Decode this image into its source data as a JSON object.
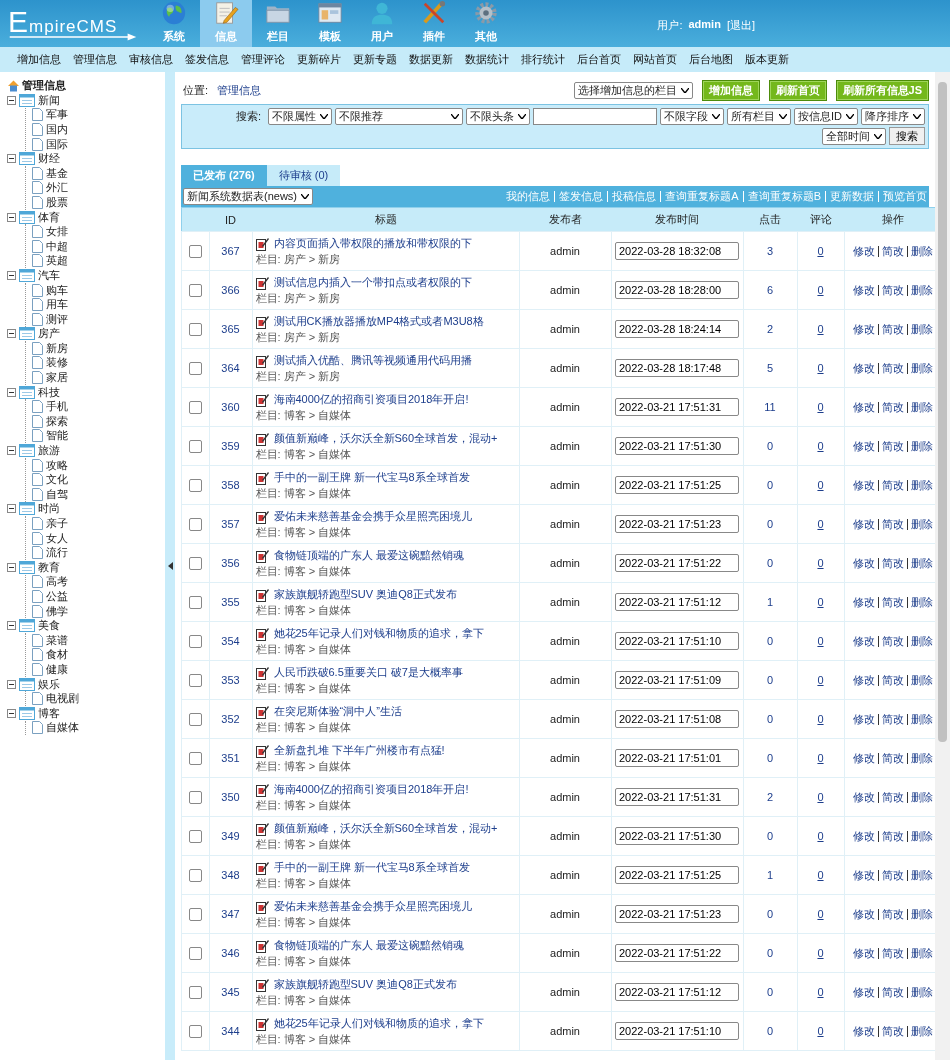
{
  "header": {
    "logo": {
      "initial": "E",
      "rest": "mpireCMS"
    },
    "tabs": [
      {
        "label": "系统",
        "selected": false
      },
      {
        "label": "信息",
        "selected": true
      },
      {
        "label": "栏目",
        "selected": false
      },
      {
        "label": "模板",
        "selected": false
      },
      {
        "label": "用户",
        "selected": false
      },
      {
        "label": "插件",
        "selected": false
      },
      {
        "label": "其他",
        "selected": false
      }
    ],
    "user": {
      "label": "用户:",
      "name": "admin",
      "logout": "[退出]"
    }
  },
  "menu": [
    "增加信息",
    "管理信息",
    "审核信息",
    "签发信息",
    "管理评论",
    "更新碎片",
    "更新专题",
    "数据更新",
    "数据统计",
    "排行统计",
    "后台首页",
    "网站首页",
    "后台地图",
    "版本更新"
  ],
  "sidebar": {
    "root": "管理信息",
    "items": [
      {
        "label": "新闻",
        "expanded": true,
        "children": [
          {
            "label": "军事"
          },
          {
            "label": "国内"
          },
          {
            "label": "国际"
          }
        ]
      },
      {
        "label": "财经",
        "expanded": true,
        "children": [
          {
            "label": "基金"
          },
          {
            "label": "外汇"
          },
          {
            "label": "股票"
          }
        ]
      },
      {
        "label": "体育",
        "expanded": true,
        "children": [
          {
            "label": "女排"
          },
          {
            "label": "中超"
          },
          {
            "label": "英超"
          }
        ]
      },
      {
        "label": "汽车",
        "expanded": true,
        "children": [
          {
            "label": "购车"
          },
          {
            "label": "用车"
          },
          {
            "label": "测评"
          }
        ]
      },
      {
        "label": "房产",
        "expanded": true,
        "children": [
          {
            "label": "新房"
          },
          {
            "label": "装修"
          },
          {
            "label": "家居"
          }
        ]
      },
      {
        "label": "科技",
        "expanded": true,
        "children": [
          {
            "label": "手机"
          },
          {
            "label": "探索"
          },
          {
            "label": "智能"
          }
        ]
      },
      {
        "label": "旅游",
        "expanded": true,
        "children": [
          {
            "label": "攻略"
          },
          {
            "label": "文化"
          },
          {
            "label": "自驾"
          }
        ]
      },
      {
        "label": "时尚",
        "expanded": true,
        "children": [
          {
            "label": "亲子"
          },
          {
            "label": "女人"
          },
          {
            "label": "流行"
          }
        ]
      },
      {
        "label": "教育",
        "expanded": true,
        "children": [
          {
            "label": "高考"
          },
          {
            "label": "公益"
          },
          {
            "label": "佛学"
          }
        ]
      },
      {
        "label": "美食",
        "expanded": true,
        "children": [
          {
            "label": "菜谱"
          },
          {
            "label": "食材"
          },
          {
            "label": "健康"
          }
        ]
      },
      {
        "label": "娱乐",
        "expanded": true,
        "children": [
          {
            "label": "电视剧"
          }
        ]
      },
      {
        "label": "博客",
        "expanded": true,
        "children": [
          {
            "label": "自媒体"
          }
        ]
      }
    ]
  },
  "location": {
    "label": "位置:",
    "link": "管理信息"
  },
  "add_column_select": "选择增加信息的栏目",
  "action_buttons": [
    "增加信息",
    "刷新首页",
    "刷新所有信息JS"
  ],
  "search": {
    "label": "搜索:",
    "filters": [
      "不限属性",
      "不限推荐",
      "不限头条"
    ],
    "filters_2": [
      "不限字段",
      "所有栏目",
      "按信息ID",
      "降序排序",
      "全部时间"
    ],
    "button": "搜索"
  },
  "tabs": [
    {
      "label": "已发布 (276)",
      "selected": true
    },
    {
      "label": "待审核 (0)",
      "selected": false
    }
  ],
  "table_select": "新闻系统数据表(news)",
  "table_links": [
    "我的信息",
    "签发信息",
    "投稿信息",
    "查询重复标题A",
    "查询重复标题B",
    "更新数据",
    "预览首页"
  ],
  "table": {
    "columns": [
      "ID",
      "标题",
      "发布者",
      "发布时间",
      "点击",
      "评论",
      "操作"
    ],
    "rows": [
      {
        "checked": false,
        "id": "367",
        "title": "内容页面插入带权限的播放和带权限的下",
        "category": "栏目: 房产 > 新房",
        "author": "admin",
        "time": "2022-03-28 18:32:08",
        "clicks": "3",
        "comments": "0",
        "actions": [
          "修改",
          "简改",
          "删除"
        ]
      },
      {
        "checked": false,
        "id": "366",
        "title": "测试信息内插入一个带扣点或者权限的下",
        "category": "栏目: 房产 > 新房",
        "author": "admin",
        "time": "2022-03-28 18:28:00",
        "clicks": "6",
        "comments": "0",
        "actions": [
          "修改",
          "简改",
          "删除"
        ]
      },
      {
        "checked": false,
        "id": "365",
        "title": "测试用CK播放器播放MP4格式或者M3U8格",
        "category": "栏目: 房产 > 新房",
        "author": "admin",
        "time": "2022-03-28 18:24:14",
        "clicks": "2",
        "comments": "0",
        "actions": [
          "修改",
          "简改",
          "删除"
        ]
      },
      {
        "checked": false,
        "id": "364",
        "title": "测试插入优酷、腾讯等视频通用代码用播",
        "category": "栏目: 房产 > 新房",
        "author": "admin",
        "time": "2022-03-28 18:17:48",
        "clicks": "5",
        "comments": "0",
        "actions": [
          "修改",
          "简改",
          "删除"
        ]
      },
      {
        "checked": false,
        "id": "360",
        "title": "海南4000亿的招商引资项目2018年开启!",
        "category": "栏目: 博客 > 自媒体",
        "author": "admin",
        "time": "2022-03-21 17:51:31",
        "clicks": "11",
        "comments": "0",
        "actions": [
          "修改",
          "简改",
          "删除"
        ]
      },
      {
        "checked": false,
        "id": "359",
        "title": "颜值新巅峰，沃尔沃全新S60全球首发，混动+",
        "category": "栏目: 博客 > 自媒体",
        "author": "admin",
        "time": "2022-03-21 17:51:30",
        "clicks": "0",
        "comments": "0",
        "actions": [
          "修改",
          "简改",
          "删除"
        ]
      },
      {
        "checked": false,
        "id": "358",
        "title": "手中的一副王牌 新一代宝马8系全球首发",
        "category": "栏目: 博客 > 自媒体",
        "author": "admin",
        "time": "2022-03-21 17:51:25",
        "clicks": "0",
        "comments": "0",
        "actions": [
          "修改",
          "简改",
          "删除"
        ]
      },
      {
        "checked": false,
        "id": "357",
        "title": "爱佑未来慈善基金会携手众星照亮困境儿",
        "category": "栏目: 博客 > 自媒体",
        "author": "admin",
        "time": "2022-03-21 17:51:23",
        "clicks": "0",
        "comments": "0",
        "actions": [
          "修改",
          "简改",
          "删除"
        ]
      },
      {
        "checked": false,
        "id": "356",
        "title": "食物链顶端的广东人 最爱这碗黯然销魂",
        "category": "栏目: 博客 > 自媒体",
        "author": "admin",
        "time": "2022-03-21 17:51:22",
        "clicks": "0",
        "comments": "0",
        "actions": [
          "修改",
          "简改",
          "删除"
        ]
      },
      {
        "checked": false,
        "id": "355",
        "title": "家族旗舰轿跑型SUV 奥迪Q8正式发布",
        "category": "栏目: 博客 > 自媒体",
        "author": "admin",
        "time": "2022-03-21 17:51:12",
        "clicks": "1",
        "comments": "0",
        "actions": [
          "修改",
          "简改",
          "删除"
        ]
      },
      {
        "checked": false,
        "id": "354",
        "title": "她花25年记录人们对钱和物质的追求，拿下",
        "category": "栏目: 博客 > 自媒体",
        "author": "admin",
        "time": "2022-03-21 17:51:10",
        "clicks": "0",
        "comments": "0",
        "actions": [
          "修改",
          "简改",
          "删除"
        ]
      },
      {
        "checked": false,
        "id": "353",
        "title": "人民币跌破6.5重要关口 破7是大概率事",
        "category": "栏目: 博客 > 自媒体",
        "author": "admin",
        "time": "2022-03-21 17:51:09",
        "clicks": "0",
        "comments": "0",
        "actions": [
          "修改",
          "简改",
          "删除"
        ]
      },
      {
        "checked": false,
        "id": "352",
        "title": "在突尼斯体验“洞中人”生活",
        "category": "栏目: 博客 > 自媒体",
        "author": "admin",
        "time": "2022-03-21 17:51:08",
        "clicks": "0",
        "comments": "0",
        "actions": [
          "修改",
          "简改",
          "删除"
        ]
      },
      {
        "checked": false,
        "id": "351",
        "title": "全新盘扎堆 下半年广州楼市有点猛!",
        "category": "栏目: 博客 > 自媒体",
        "author": "admin",
        "time": "2022-03-21 17:51:01",
        "clicks": "0",
        "comments": "0",
        "actions": [
          "修改",
          "简改",
          "删除"
        ]
      },
      {
        "checked": false,
        "id": "350",
        "title": "海南4000亿的招商引资项目2018年开启!",
        "category": "栏目: 博客 > 自媒体",
        "author": "admin",
        "time": "2022-03-21 17:51:31",
        "clicks": "2",
        "comments": "0",
        "actions": [
          "修改",
          "简改",
          "删除"
        ]
      },
      {
        "checked": false,
        "id": "349",
        "title": "颜值新巅峰，沃尔沃全新S60全球首发，混动+",
        "category": "栏目: 博客 > 自媒体",
        "author": "admin",
        "time": "2022-03-21 17:51:30",
        "clicks": "0",
        "comments": "0",
        "actions": [
          "修改",
          "简改",
          "删除"
        ]
      },
      {
        "checked": false,
        "id": "348",
        "title": "手中的一副王牌 新一代宝马8系全球首发",
        "category": "栏目: 博客 > 自媒体",
        "author": "admin",
        "time": "2022-03-21 17:51:25",
        "clicks": "1",
        "comments": "0",
        "actions": [
          "修改",
          "简改",
          "删除"
        ]
      },
      {
        "checked": false,
        "id": "347",
        "title": "爱佑未来慈善基金会携手众星照亮困境儿",
        "category": "栏目: 博客 > 自媒体",
        "author": "admin",
        "time": "2022-03-21 17:51:23",
        "clicks": "0",
        "comments": "0",
        "actions": [
          "修改",
          "简改",
          "删除"
        ]
      },
      {
        "checked": false,
        "id": "346",
        "title": "食物链顶端的广东人 最爱这碗黯然销魂",
        "category": "栏目: 博客 > 自媒体",
        "author": "admin",
        "time": "2022-03-21 17:51:22",
        "clicks": "0",
        "comments": "0",
        "actions": [
          "修改",
          "简改",
          "删除"
        ]
      },
      {
        "checked": false,
        "id": "345",
        "title": "家族旗舰轿跑型SUV 奥迪Q8正式发布",
        "category": "栏目: 博客 > 自媒体",
        "author": "admin",
        "time": "2022-03-21 17:51:12",
        "clicks": "0",
        "comments": "0",
        "actions": [
          "修改",
          "简改",
          "删除"
        ]
      },
      {
        "checked": false,
        "id": "344",
        "title": "她花25年记录人们对钱和物质的追求，拿下",
        "category": "栏目: 博客 > 自媒体",
        "author": "admin",
        "time": "2022-03-21 17:51:10",
        "clicks": "0",
        "comments": "0",
        "actions": [
          "修改",
          "简改",
          "删除"
        ]
      }
    ]
  }
}
